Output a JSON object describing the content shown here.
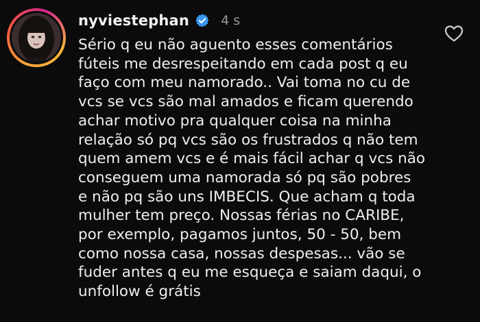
{
  "comment": {
    "username": "nyviestephan",
    "timestamp": "4 s",
    "icons": {
      "verified": "verified-badge-icon",
      "like": "heart-outline-icon"
    },
    "colors": {
      "verified_badge": "#3797f0",
      "background": "#0b0b0b",
      "text": "#efefef",
      "timestamp": "#9b9b9b"
    },
    "lines": [
      "Sério q eu não aguento esses comentários",
      "fúteis me desrespeitando em cada post q eu",
      "faço com meu namorado.. Vai toma no cu de",
      "vcs se vcs são mal amados e ficam querendo",
      "achar motivo pra qualquer coisa na minha",
      "relação só pq vcs são os frustrados q não tem",
      "quem amem vcs e é mais fácil achar q vcs não",
      "conseguem uma namorada só pq são pobres",
      "e não pq são uns IMBECIS. Que acham q toda",
      "mulher tem preço. Nossas férias no CARIBE,",
      "por exemplo, pagamos juntos, 50 - 50, bem",
      "como nossa casa, nossas despesas... vão se",
      "fuder antes q eu me esqueça e saiam daqui, o",
      "unfollow é grátis"
    ]
  }
}
